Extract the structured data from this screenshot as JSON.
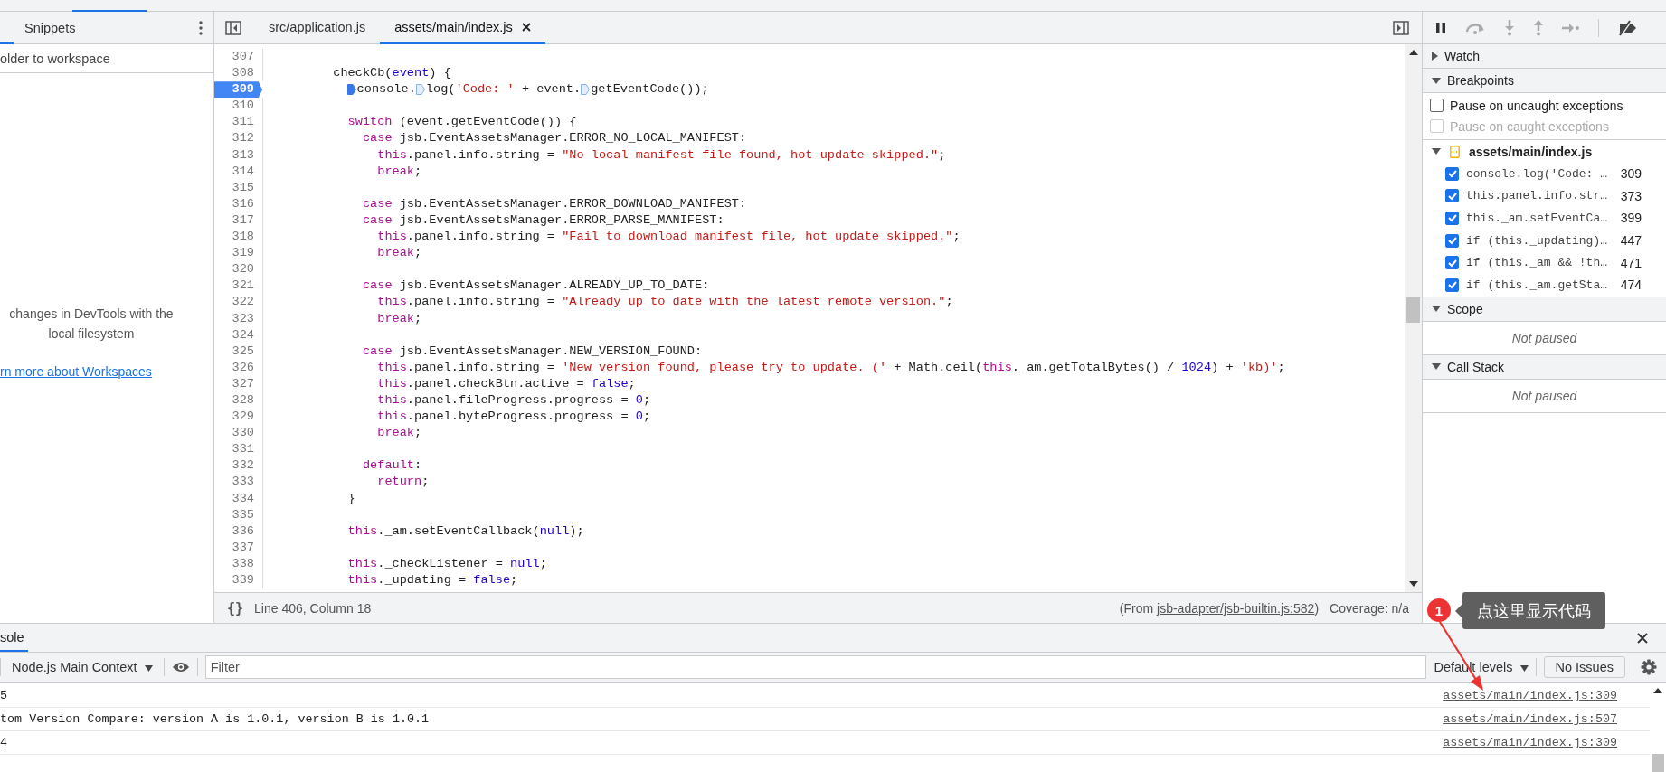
{
  "navigator": {
    "tabs": [
      {
        "label": "Snippets",
        "selected": false
      }
    ],
    "folder_row": "older to workspace",
    "hint_lines": [
      "changes in DevTools with the",
      "local filesystem"
    ],
    "link": "rn more about Workspaces"
  },
  "editor": {
    "tabs": [
      {
        "label": "src/application.js",
        "selected": false,
        "closable": false
      },
      {
        "label": "assets/main/index.js",
        "selected": true,
        "closable": true
      }
    ],
    "lines": [
      {
        "number": "307",
        "breakpoint": false
      },
      {
        "number": "308",
        "breakpoint": false,
        "tokens": [
          {
            "kind": "plain",
            "text": "        checkCb("
          },
          {
            "kind": "param",
            "text": "event"
          },
          {
            "kind": "plain",
            "text": ") {"
          }
        ]
      },
      {
        "number": "309",
        "breakpoint": true,
        "tokens": [
          {
            "kind": "marker",
            "active": true
          },
          {
            "kind": "plain",
            "text": "          console."
          },
          {
            "kind": "marker",
            "active": false
          },
          {
            "kind": "plain",
            "text": "log("
          },
          {
            "kind": "string",
            "text": "'Code: '"
          },
          {
            "kind": "plain",
            "text": " + event."
          },
          {
            "kind": "marker",
            "active": false
          },
          {
            "kind": "plain",
            "text": "getEventCode());"
          }
        ]
      },
      {
        "number": "310",
        "breakpoint": false
      },
      {
        "number": "311",
        "breakpoint": false,
        "tokens": [
          {
            "kind": "keyword",
            "text": "          switch"
          },
          {
            "kind": "plain",
            "text": " (event.getEventCode()) {"
          }
        ]
      },
      {
        "number": "312",
        "breakpoint": false,
        "tokens": [
          {
            "kind": "keyword",
            "text": "            case"
          },
          {
            "kind": "plain",
            "text": " jsb.EventAssetsManager.ERROR_NO_LOCAL_MANIFEST:"
          }
        ]
      },
      {
        "number": "313",
        "breakpoint": false,
        "tokens": [
          {
            "kind": "keyword",
            "text": "              this"
          },
          {
            "kind": "plain",
            "text": ".panel.info.string = "
          },
          {
            "kind": "string",
            "text": "\"No local manifest file found, hot update skipped.\""
          },
          {
            "kind": "plain",
            "text": ";"
          }
        ]
      },
      {
        "number": "314",
        "breakpoint": false,
        "tokens": [
          {
            "kind": "keyword",
            "text": "              break"
          },
          {
            "kind": "plain",
            "text": ";"
          }
        ]
      },
      {
        "number": "315",
        "breakpoint": false
      },
      {
        "number": "316",
        "breakpoint": false,
        "tokens": [
          {
            "kind": "keyword",
            "text": "            case"
          },
          {
            "kind": "plain",
            "text": " jsb.EventAssetsManager.ERROR_DOWNLOAD_MANIFEST:"
          }
        ]
      },
      {
        "number": "317",
        "breakpoint": false,
        "tokens": [
          {
            "kind": "keyword",
            "text": "            case"
          },
          {
            "kind": "plain",
            "text": " jsb.EventAssetsManager.ERROR_PARSE_MANIFEST:"
          }
        ]
      },
      {
        "number": "318",
        "breakpoint": false,
        "tokens": [
          {
            "kind": "keyword",
            "text": "              this"
          },
          {
            "kind": "plain",
            "text": ".panel.info.string = "
          },
          {
            "kind": "string",
            "text": "\"Fail to download manifest file, hot update skipped.\""
          },
          {
            "kind": "plain",
            "text": ";"
          }
        ]
      },
      {
        "number": "319",
        "breakpoint": false,
        "tokens": [
          {
            "kind": "keyword",
            "text": "              break"
          },
          {
            "kind": "plain",
            "text": ";"
          }
        ]
      },
      {
        "number": "320",
        "breakpoint": false
      },
      {
        "number": "321",
        "breakpoint": false,
        "tokens": [
          {
            "kind": "keyword",
            "text": "            case"
          },
          {
            "kind": "plain",
            "text": " jsb.EventAssetsManager.ALREADY_UP_TO_DATE:"
          }
        ]
      },
      {
        "number": "322",
        "breakpoint": false,
        "tokens": [
          {
            "kind": "keyword",
            "text": "              this"
          },
          {
            "kind": "plain",
            "text": ".panel.info.string = "
          },
          {
            "kind": "string",
            "text": "\"Already up to date with the latest remote version.\""
          },
          {
            "kind": "plain",
            "text": ";"
          }
        ]
      },
      {
        "number": "323",
        "breakpoint": false,
        "tokens": [
          {
            "kind": "keyword",
            "text": "              break"
          },
          {
            "kind": "plain",
            "text": ";"
          }
        ]
      },
      {
        "number": "324",
        "breakpoint": false
      },
      {
        "number": "325",
        "breakpoint": false,
        "tokens": [
          {
            "kind": "keyword",
            "text": "            case"
          },
          {
            "kind": "plain",
            "text": " jsb.EventAssetsManager.NEW_VERSION_FOUND:"
          }
        ]
      },
      {
        "number": "326",
        "breakpoint": false,
        "tokens": [
          {
            "kind": "keyword",
            "text": "              this"
          },
          {
            "kind": "plain",
            "text": ".panel.info.string = "
          },
          {
            "kind": "string",
            "text": "'New version found, please try to update. ('"
          },
          {
            "kind": "plain",
            "text": " + Math.ceil("
          },
          {
            "kind": "keyword",
            "text": "this"
          },
          {
            "kind": "plain",
            "text": "._am.getTotalBytes() / "
          },
          {
            "kind": "literal",
            "text": "1024"
          },
          {
            "kind": "plain",
            "text": ") + "
          },
          {
            "kind": "string",
            "text": "'kb)'"
          },
          {
            "kind": "plain",
            "text": ";"
          }
        ]
      },
      {
        "number": "327",
        "breakpoint": false,
        "tokens": [
          {
            "kind": "keyword",
            "text": "              this"
          },
          {
            "kind": "plain",
            "text": ".panel.checkBtn.active = "
          },
          {
            "kind": "literal",
            "text": "false"
          },
          {
            "kind": "plain",
            "text": ";"
          }
        ]
      },
      {
        "number": "328",
        "breakpoint": false,
        "tokens": [
          {
            "kind": "keyword",
            "text": "              this"
          },
          {
            "kind": "plain",
            "text": ".panel.fileProgress.progress = "
          },
          {
            "kind": "literal",
            "text": "0"
          },
          {
            "kind": "plain",
            "text": ";"
          }
        ]
      },
      {
        "number": "329",
        "breakpoint": false,
        "tokens": [
          {
            "kind": "keyword",
            "text": "              this"
          },
          {
            "kind": "plain",
            "text": ".panel.byteProgress.progress = "
          },
          {
            "kind": "literal",
            "text": "0"
          },
          {
            "kind": "plain",
            "text": ";"
          }
        ]
      },
      {
        "number": "330",
        "breakpoint": false,
        "tokens": [
          {
            "kind": "keyword",
            "text": "              break"
          },
          {
            "kind": "plain",
            "text": ";"
          }
        ]
      },
      {
        "number": "331",
        "breakpoint": false
      },
      {
        "number": "332",
        "breakpoint": false,
        "tokens": [
          {
            "kind": "keyword",
            "text": "            default"
          },
          {
            "kind": "plain",
            "text": ":"
          }
        ]
      },
      {
        "number": "333",
        "breakpoint": false,
        "tokens": [
          {
            "kind": "keyword",
            "text": "              return"
          },
          {
            "kind": "plain",
            "text": ";"
          }
        ]
      },
      {
        "number": "334",
        "breakpoint": false,
        "tokens": [
          {
            "kind": "plain",
            "text": "          }"
          }
        ]
      },
      {
        "number": "335",
        "breakpoint": false
      },
      {
        "number": "336",
        "breakpoint": false,
        "tokens": [
          {
            "kind": "keyword",
            "text": "          this"
          },
          {
            "kind": "plain",
            "text": "._am.setEventCallback("
          },
          {
            "kind": "literal",
            "text": "null"
          },
          {
            "kind": "plain",
            "text": ");"
          }
        ]
      },
      {
        "number": "337",
        "breakpoint": false
      },
      {
        "number": "338",
        "breakpoint": false,
        "tokens": [
          {
            "kind": "keyword",
            "text": "          this"
          },
          {
            "kind": "plain",
            "text": "._checkListener = "
          },
          {
            "kind": "literal",
            "text": "null"
          },
          {
            "kind": "plain",
            "text": ";"
          }
        ]
      },
      {
        "number": "339",
        "breakpoint": false,
        "tokens": [
          {
            "kind": "keyword",
            "text": "          this"
          },
          {
            "kind": "plain",
            "text": "._updating = "
          },
          {
            "kind": "literal",
            "text": "false"
          },
          {
            "kind": "plain",
            "text": ";"
          }
        ]
      }
    ],
    "status": {
      "format_glyph": "{}",
      "position": "Line 406, Column 18",
      "from_prefix": "(From ",
      "from_link": "jsb-adapter/jsb-builtin.js:582",
      "from_suffix": ")",
      "coverage": "Coverage: n/a"
    }
  },
  "debugger": {
    "watch": {
      "title": "Watch",
      "expanded": false
    },
    "breakpoints": {
      "title": "Breakpoints",
      "expanded": true,
      "pause_options": [
        {
          "label": "Pause on uncaught exceptions",
          "checked": false,
          "disabled": false
        },
        {
          "label": "Pause on caught exceptions",
          "checked": false,
          "disabled": true
        }
      ],
      "file": {
        "name": "assets/main/index.js",
        "expanded": true,
        "items": [
          {
            "code": "console.log('Code: …",
            "line": "309",
            "checked": true
          },
          {
            "code": "this.panel.info.str…",
            "line": "373",
            "checked": true
          },
          {
            "code": "this._am.setEventCa…",
            "line": "399",
            "checked": true
          },
          {
            "code": "if (this._updating)…",
            "line": "447",
            "checked": true
          },
          {
            "code": "if (this._am && !th…",
            "line": "471",
            "checked": true
          },
          {
            "code": "if (this._am.getSta…",
            "line": "474",
            "checked": true
          }
        ]
      }
    },
    "scope": {
      "title": "Scope",
      "expanded": true,
      "message": "Not paused"
    },
    "call_stack": {
      "title": "Call Stack",
      "expanded": true,
      "message": "Not paused"
    }
  },
  "console": {
    "tab": "sole",
    "context": "Node.js Main Context",
    "filter_placeholder": "Filter",
    "levels": "Default levels",
    "issues": "No Issues",
    "messages": [
      {
        "text": "5",
        "source": "assets/main/index.js:309"
      },
      {
        "text": "tom Version Compare: version A is 1.0.1, version B is 1.0.1",
        "source": "assets/main/index.js:507"
      },
      {
        "text": "4",
        "source": "assets/main/index.js:309"
      }
    ]
  },
  "annotation": {
    "number": "1",
    "note": "点这里显示代码"
  }
}
